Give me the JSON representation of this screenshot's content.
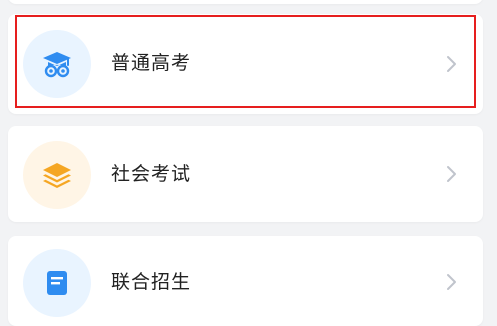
{
  "items": [
    {
      "label": "普通高考",
      "icon": "graduation-cap-icon",
      "icon_bg": "#e9f4ff",
      "icon_color": "#2f8cf0",
      "selected": true
    },
    {
      "label": "社会考试",
      "icon": "layers-icon",
      "icon_bg": "#fff5e6",
      "icon_color": "#f5a623",
      "selected": false
    },
    {
      "label": "联合招生",
      "icon": "document-icon",
      "icon_bg": "#e9f4ff",
      "icon_color": "#2f8cf0",
      "selected": false
    }
  ],
  "colors": {
    "highlight": "#e61e1e",
    "chevron": "#c0c4cc"
  }
}
